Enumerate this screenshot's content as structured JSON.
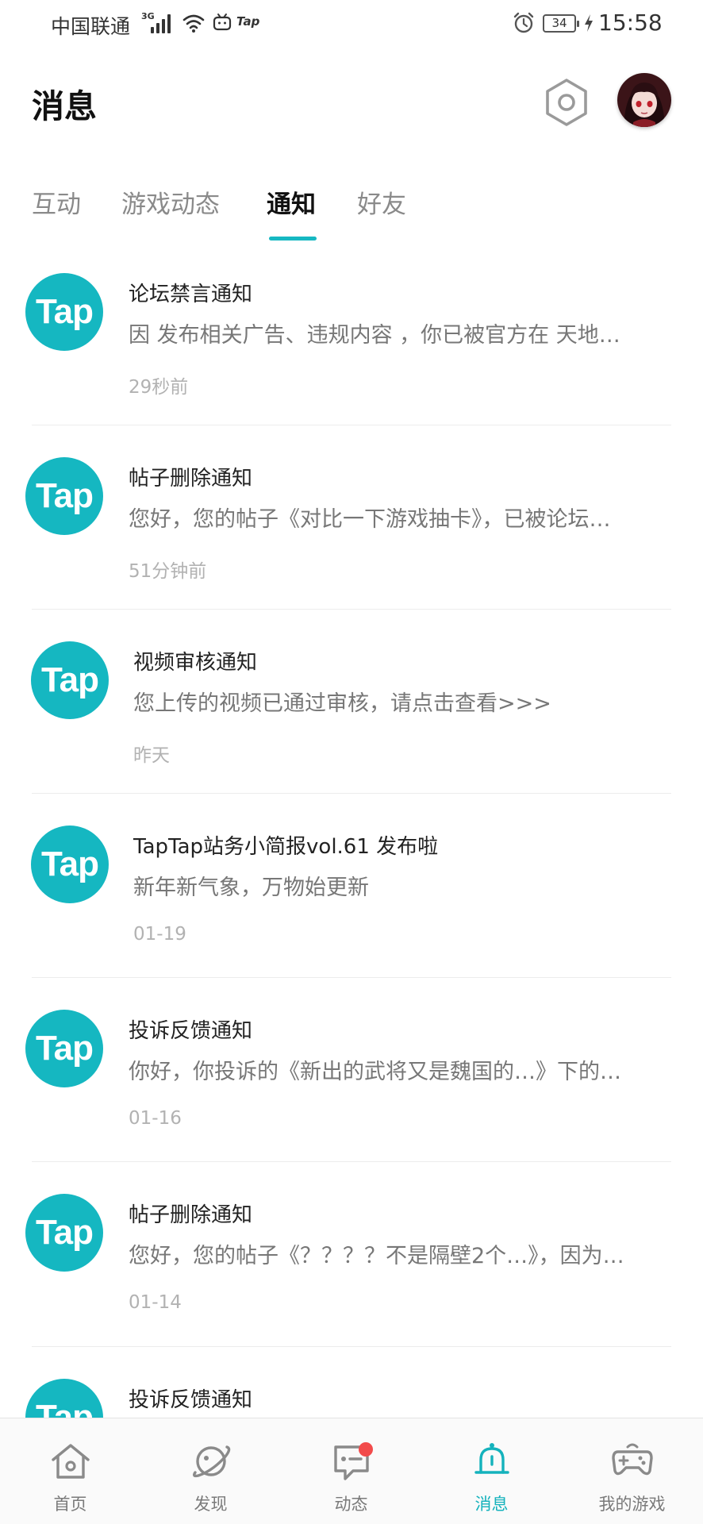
{
  "status_bar": {
    "carrier": "中国联通",
    "network": "3G",
    "app_badge": "Tap",
    "battery": "34",
    "time": "15:58"
  },
  "header": {
    "title": "消息",
    "settings_icon": "hexagon-gear-icon",
    "avatar_icon": "user-avatar"
  },
  "tabs": [
    {
      "label": "互动",
      "active": false
    },
    {
      "label": "游戏动态",
      "active": false
    },
    {
      "label": "通知",
      "active": true
    },
    {
      "label": "好友",
      "active": false
    }
  ],
  "accent_color": "#16b8c2",
  "notifications": [
    {
      "logo": "Tap",
      "title": "论坛禁言通知",
      "body": "因 发布相关广告、违规内容 ，你已被官方在 天地…",
      "time": "29秒前"
    },
    {
      "logo": "Tap",
      "title": "帖子删除通知",
      "body": "您好，您的帖子《对比一下游戏抽卡》，已被论坛…",
      "time": "51分钟前"
    },
    {
      "logo": "Tap",
      "title": "视频审核通知",
      "body": "您上传的视频已通过审核，请点击查看>>>",
      "time": "昨天"
    },
    {
      "logo": "Tap",
      "title": "TapTap站务小简报vol.61 发布啦",
      "body": "新年新气象，万物始更新",
      "time": "01-19"
    },
    {
      "logo": "Tap",
      "title": "投诉反馈通知",
      "body": "你好，你投诉的《新出的武将又是魏国的…》下的…",
      "time": "01-16"
    },
    {
      "logo": "Tap",
      "title": "帖子删除通知",
      "body": "您好，您的帖子《？？？？不是隔壁2个…》，因为…",
      "time": "01-14"
    },
    {
      "logo": "Tap",
      "title": "投诉反馈通知",
      "body": "",
      "time": ""
    }
  ],
  "bottom_nav": [
    {
      "label": "首页",
      "icon": "home-icon",
      "active": false
    },
    {
      "label": "发现",
      "icon": "planet-icon",
      "active": false
    },
    {
      "label": "动态",
      "icon": "chat-bubble-icon",
      "active": false,
      "badge": true
    },
    {
      "label": "消息",
      "icon": "bell-icon",
      "active": true
    },
    {
      "label": "我的游戏",
      "icon": "gamepad-icon",
      "active": false
    }
  ]
}
